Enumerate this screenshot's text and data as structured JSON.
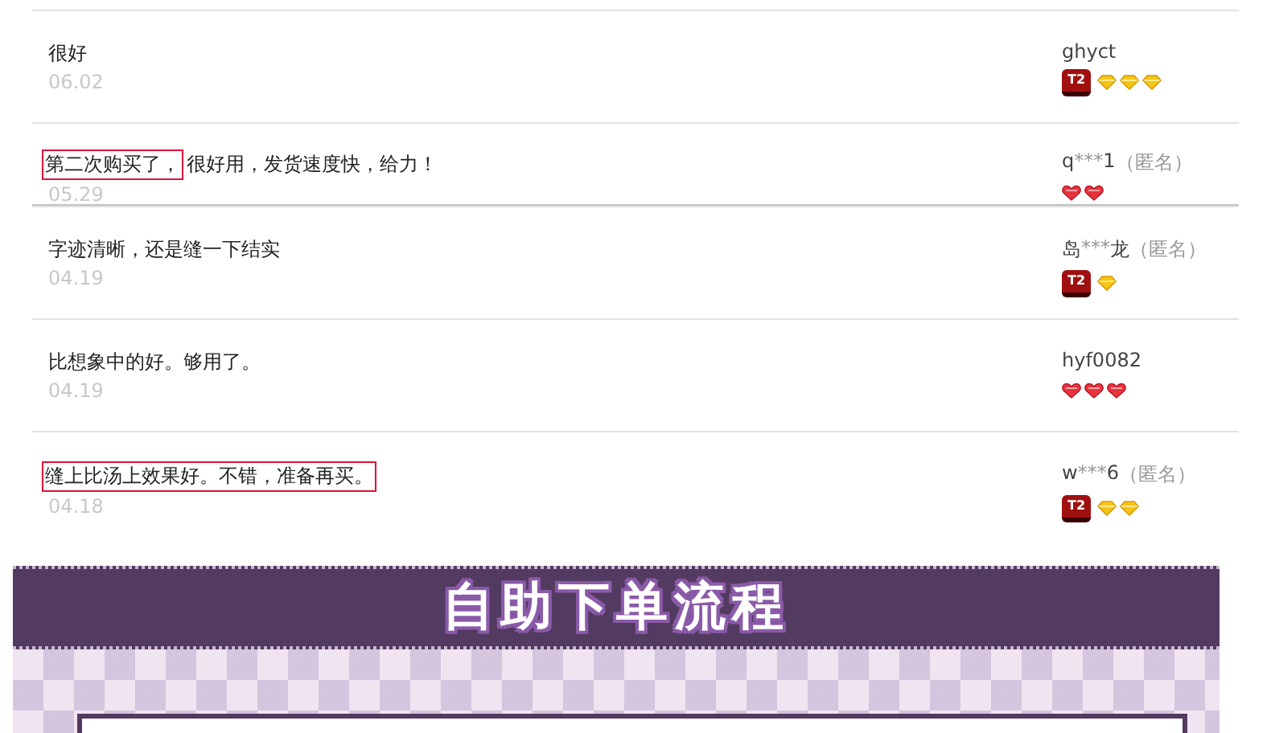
{
  "reviews": [
    {
      "text": "很好",
      "date": "06.02",
      "user": [
        {
          "text": "ghyct",
          "masked": false
        }
      ],
      "badge": "T2",
      "rank_icons": [
        {
          "kind": "diamond"
        },
        {
          "kind": "diamond"
        },
        {
          "kind": "diamond"
        }
      ]
    },
    {
      "highlight": "第二次购买了，",
      "text": "很好用，发货速度快，给力！",
      "date": "05.29",
      "user": [
        {
          "text": "q",
          "masked": false
        },
        {
          "text": "***",
          "masked": true
        },
        {
          "text": "1",
          "masked": false
        }
      ],
      "anonymous": "（匿名）",
      "rank_icons": [
        {
          "kind": "heart"
        },
        {
          "kind": "heart"
        }
      ]
    },
    {
      "text": "字迹清晰，还是缝一下结实",
      "date": "04.19",
      "user": [
        {
          "text": "岛",
          "masked": false
        },
        {
          "text": "***",
          "masked": true
        },
        {
          "text": "龙",
          "masked": false
        }
      ],
      "anonymous": "（匿名）",
      "badge": "T2",
      "rank_icons": [
        {
          "kind": "diamond"
        }
      ]
    },
    {
      "text": "比想象中的好。够用了。",
      "date": "04.19",
      "user": [
        {
          "text": "hyf0082",
          "masked": false
        }
      ],
      "rank_icons": [
        {
          "kind": "heart"
        },
        {
          "kind": "heart"
        },
        {
          "kind": "heart"
        }
      ]
    },
    {
      "highlight": "缝上比汤上效果好。不错，准备再买。",
      "date": "04.18",
      "user": [
        {
          "text": "w",
          "masked": false
        },
        {
          "text": "***",
          "masked": true
        },
        {
          "text": "6",
          "masked": false
        }
      ],
      "anonymous": "（匿名）",
      "badge": "T2",
      "rank_icons": [
        {
          "kind": "diamond"
        },
        {
          "kind": "diamond"
        }
      ]
    }
  ],
  "banner": {
    "title": "自助下单流程"
  }
}
